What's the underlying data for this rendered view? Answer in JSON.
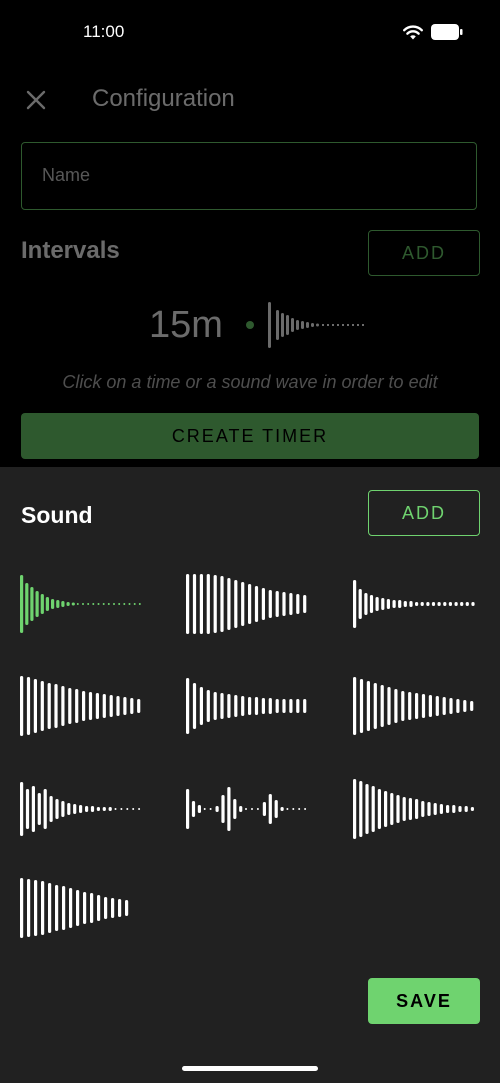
{
  "status_bar": {
    "time": "11:00",
    "icons": [
      "wifi-icon",
      "battery-icon"
    ]
  },
  "header": {
    "title": "Configuration",
    "close_icon": "close-icon"
  },
  "name_field": {
    "placeholder": "Name",
    "value": ""
  },
  "intervals": {
    "label": "Intervals",
    "add_label": "ADD",
    "interval_time": "15m",
    "hint": "Click on a time or a sound wave in order to edit"
  },
  "create_label": "CREATE TIMER",
  "sound_sheet": {
    "title": "Sound",
    "add_label": "ADD",
    "save_label": "SAVE",
    "selected_index": 0,
    "accent_color": "#6fd36f",
    "sounds": [
      "sound-1",
      "sound-2",
      "sound-3",
      "sound-4",
      "sound-5",
      "sound-6",
      "sound-7",
      "sound-8",
      "sound-9",
      "sound-10"
    ]
  },
  "colors": {
    "accent": "#6fd36f",
    "sheet": "#212121",
    "background": "#000000"
  }
}
